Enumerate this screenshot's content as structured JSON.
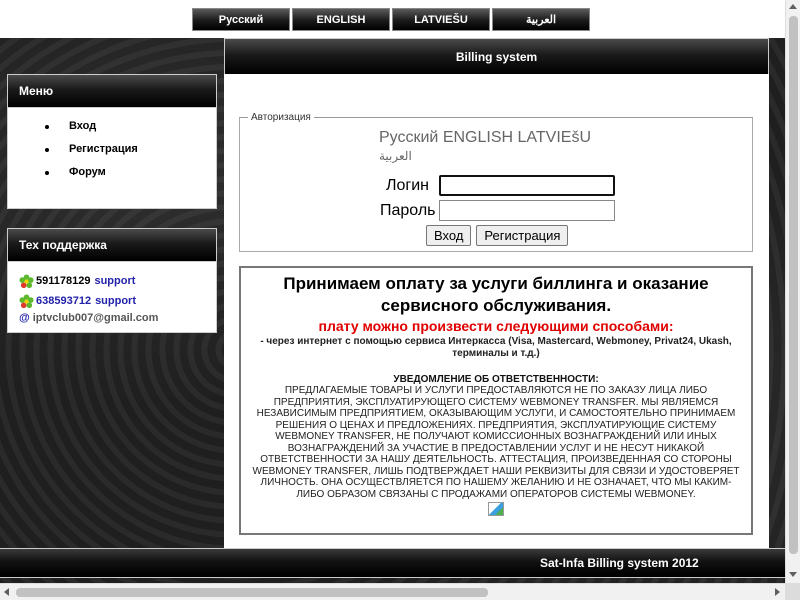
{
  "lang_bar": [
    "Русский",
    "ENGLISH",
    "LATVIEŠU",
    "العربية"
  ],
  "main": {
    "title": "Billing system"
  },
  "menu": {
    "title": "Меню",
    "items": [
      "Вход",
      "Регистрация",
      "Форум"
    ]
  },
  "support": {
    "title": "Тех поддержка",
    "contacts": [
      {
        "number": "591178129",
        "link": "support"
      },
      {
        "number": "638593712",
        "link": "support"
      }
    ],
    "email_symbol": "@",
    "email": "iptvclub007@gmail.com"
  },
  "auth": {
    "legend": "Авторизация",
    "langs": "Русский ENGLISH LATVIEšU",
    "langs_arabic": "العربية",
    "login_label": "Логин",
    "password_label": "Пароль",
    "login_button": "Вход",
    "register_button": "Регистрация"
  },
  "info": {
    "title": "Принимаем оплату за услуги биллинга и оказание сервисного обслуживания.",
    "subtitle": "плату можно произвести следующими способами:",
    "via": "- через интернет с помощью сервиса Интеркасса (Visa, Mastercard, Webmoney, Privat24, Ukash, терминалы и т.д.)",
    "disclaimer_title": "УВЕДОМЛЕНИЕ ОБ ОТВЕТСТВЕННОСТИ:",
    "disclaimer_text": "Предлагаемые товары и услуги предоставляются не по заказу лица либо предприятия, эксплуатирующего систему WebMoney Transfer. Мы являемся независимым предприятием, оказывающим услуги, и самостоятельно принимаем решения о ценах и предложениях. Предприятия, эксплуатирующие систему WebMoney Transfer, не получают комиссионных вознаграждений или иных вознаграждений за участие в предоставлении услуг и не несут никакой ответственности за нашу деятельность. Аттестация, произведенная со стороны WebMoney Transfer, лишь подтверждает наши реквизиты для связи и удостоверяет личность. Она осуществляется по нашему желанию и не означает, что мы каким-либо образом связаны с продажами операторов системы WebMoney."
  },
  "footer": {
    "text": "Sat-Infa Billing system 2012"
  },
  "colors": {
    "accent_red": "#e00000",
    "link_blue": "#2222aa"
  },
  "icons": [
    "icq-flower-icon",
    "broken-image-icon"
  ]
}
